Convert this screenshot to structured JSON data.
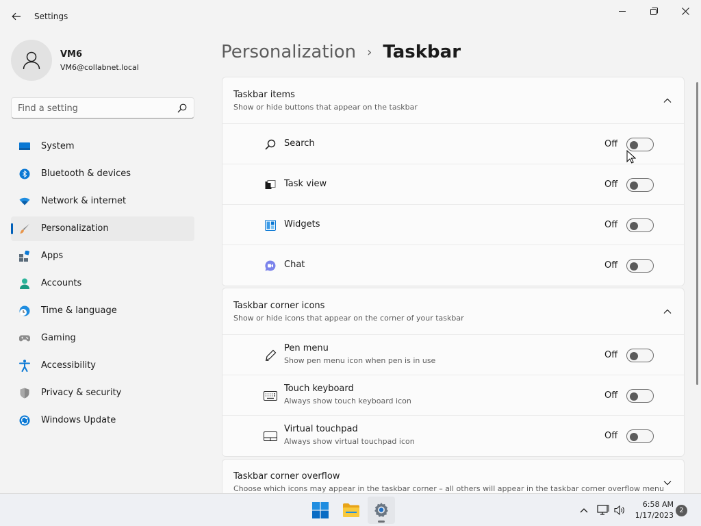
{
  "window": {
    "title": "Settings"
  },
  "user": {
    "name": "VM6",
    "email": "VM6@collabnet.local"
  },
  "search": {
    "placeholder": "Find a setting"
  },
  "sidebar": {
    "items": [
      {
        "label": "System",
        "icon": "system-icon"
      },
      {
        "label": "Bluetooth & devices",
        "icon": "bluetooth-icon"
      },
      {
        "label": "Network & internet",
        "icon": "wifi-icon"
      },
      {
        "label": "Personalization",
        "icon": "brush-icon",
        "active": true
      },
      {
        "label": "Apps",
        "icon": "apps-icon"
      },
      {
        "label": "Accounts",
        "icon": "accounts-icon"
      },
      {
        "label": "Time & language",
        "icon": "clock-globe-icon"
      },
      {
        "label": "Gaming",
        "icon": "gamepad-icon"
      },
      {
        "label": "Accessibility",
        "icon": "accessibility-icon"
      },
      {
        "label": "Privacy & security",
        "icon": "shield-icon"
      },
      {
        "label": "Windows Update",
        "icon": "update-icon"
      }
    ]
  },
  "breadcrumb": {
    "parent": "Personalization",
    "separator": "›",
    "current": "Taskbar"
  },
  "sections": {
    "taskbar_items": {
      "title": "Taskbar items",
      "subtitle": "Show or hide buttons that appear on the taskbar",
      "rows": [
        {
          "label": "Search",
          "state": "Off",
          "icon": "search-icon"
        },
        {
          "label": "Task view",
          "state": "Off",
          "icon": "task-view-icon"
        },
        {
          "label": "Widgets",
          "state": "Off",
          "icon": "widgets-icon"
        },
        {
          "label": "Chat",
          "state": "Off",
          "icon": "chat-icon"
        }
      ]
    },
    "corner_icons": {
      "title": "Taskbar corner icons",
      "subtitle": "Show or hide icons that appear on the corner of your taskbar",
      "rows": [
        {
          "label": "Pen menu",
          "sub": "Show pen menu icon when pen is in use",
          "state": "Off",
          "icon": "pen-icon"
        },
        {
          "label": "Touch keyboard",
          "sub": "Always show touch keyboard icon",
          "state": "Off",
          "icon": "keyboard-icon"
        },
        {
          "label": "Virtual touchpad",
          "sub": "Always show virtual touchpad icon",
          "state": "Off",
          "icon": "touchpad-icon"
        }
      ]
    },
    "corner_overflow": {
      "title": "Taskbar corner overflow",
      "subtitle": "Choose which icons may appear in the taskbar corner – all others will appear in the taskbar corner overflow menu"
    }
  },
  "taskbar": {
    "time": "6:58 AM",
    "date": "1/17/2023",
    "notification_count": "2"
  },
  "colors": {
    "accent": "#005fb8",
    "background": "#f3f3f3",
    "card": "#fbfbfb"
  }
}
